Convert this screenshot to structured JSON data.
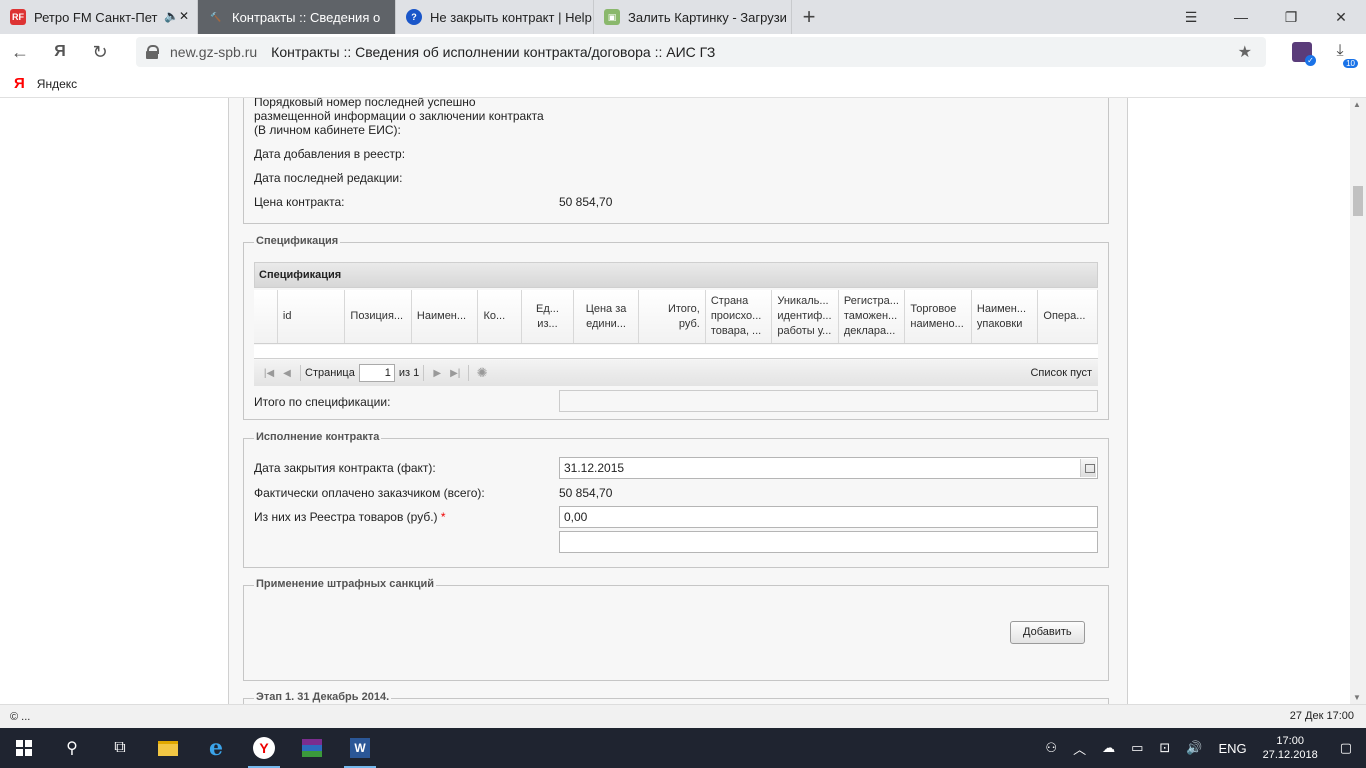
{
  "browser": {
    "tabs": [
      {
        "title": "Ретро FM Санкт-Пет",
        "favicon": "retro",
        "extra": "🔈✕"
      },
      {
        "title": "Контракты :: Сведения о",
        "favicon": "gavel",
        "active": true
      },
      {
        "title": "Не закрыть контракт | Help",
        "favicon": "help"
      },
      {
        "title": "Залить Картинку - Загрузи",
        "favicon": "image"
      }
    ],
    "new_tab": "+",
    "domain": "new.gz-spb.ru",
    "page_title": "Контракты :: Сведения об исполнении контракта/договора :: АИС ГЗ",
    "downloads_count": "10",
    "bookmark_label": "Яндекс"
  },
  "contract_info": {
    "rows": [
      {
        "label": "Порядковый номер последней успешно размещенной информации о заключении контракта (В личном кабинете ЕИС):",
        "value": ""
      },
      {
        "label": "Дата добавления в реестр:",
        "value": ""
      },
      {
        "label": "Дата последней редакции:",
        "value": ""
      },
      {
        "label": "Цена контракта:",
        "value": "50 854,70"
      }
    ]
  },
  "specification": {
    "legend": "Спецификация",
    "grid_title": "Спецификация",
    "columns": [
      {
        "label": "",
        "w": 24
      },
      {
        "label": "id",
        "w": 68
      },
      {
        "label": "Позиция...",
        "w": 67
      },
      {
        "label": "Наимен...",
        "w": 67
      },
      {
        "label": "Ко...",
        "w": 44
      },
      {
        "label": "Ед... из...",
        "w": 52
      },
      {
        "label": "Цена за едини...",
        "w": 66
      },
      {
        "label": "Итого, руб.",
        "w": 67
      },
      {
        "label": "Страна происхо... товара, ...",
        "w": 67
      },
      {
        "label": "Уникаль... идентиф... работы у...",
        "w": 67
      },
      {
        "label": "Регистра... таможен... деклара...",
        "w": 67
      },
      {
        "label": "Торговое наимено...",
        "w": 67
      },
      {
        "label": "Наимен... упаковки",
        "w": 67
      },
      {
        "label": "Опера...",
        "w": 60
      }
    ],
    "pager": {
      "page_label": "Страница",
      "page": "1",
      "of_label": "из 1",
      "empty": "Список пуст"
    },
    "total_label": "Итого по спецификации:",
    "total_value": ""
  },
  "execution": {
    "legend": "Исполнение контракта",
    "close_date_label": "Дата закрытия контракта (факт):",
    "close_date": "31.12.2015",
    "paid_label": "Фактически оплачено заказчиком (всего):",
    "paid_value": "50 854,70",
    "registry_label": "Из них из Реестра товаров (руб.)",
    "registry_value": "0,00",
    "required_mark": "*"
  },
  "penalties": {
    "legend": "Применение штрафных санкций",
    "add_button": "Добавить"
  },
  "stage": {
    "legend": "Этап 1. 31 Декабрь 2014."
  },
  "status": {
    "left": "© ...",
    "right": "27 Дек 17:00"
  },
  "taskbar": {
    "lang": "ENG",
    "time": "17:00",
    "date": "27.12.2018"
  }
}
